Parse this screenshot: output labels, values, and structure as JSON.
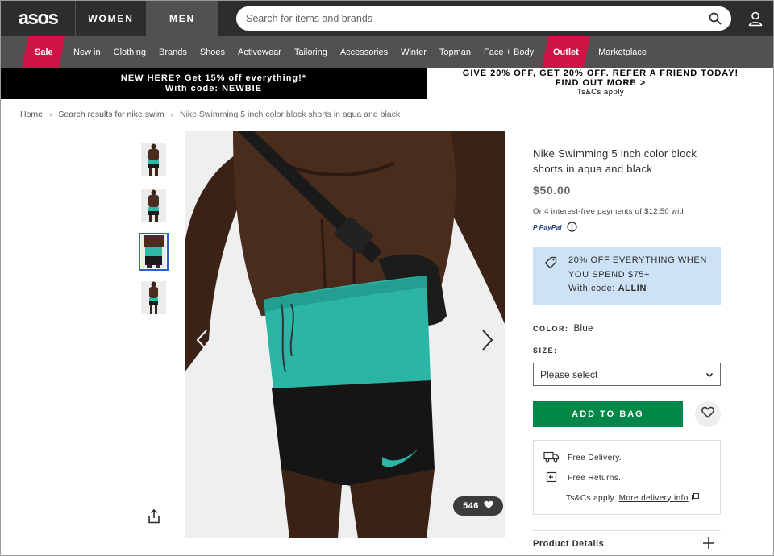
{
  "header": {
    "logo": "asos",
    "women": "WOMEN",
    "men": "MEN",
    "search_placeholder": "Search for items and brands",
    "icons": {
      "search": "search-icon",
      "account": "account-icon"
    }
  },
  "nav": {
    "sale": "Sale",
    "items_a": [
      "New in",
      "Clothing",
      "Brands",
      "Shoes",
      "Activewear",
      "Tailoring",
      "Accessories",
      "Winter",
      "Topman",
      "Face + Body"
    ],
    "outlet": "Outlet",
    "marketplace": "Marketplace",
    "sale_color": "#d01345"
  },
  "promo": {
    "left_line1": "NEW HERE? Get 15% off everything!*",
    "left_line2": "With code: NEWBIE",
    "right_line1": "GIVE 20% OFF, GET 20% OFF. REFER A FRIEND TODAY!",
    "right_line2": "FIND OUT MORE >",
    "right_tc": "Ts&Cs apply"
  },
  "breadcrumb": [
    "Home",
    "Search results for nike swim",
    "Nike Swimming 5 inch color block shorts in aqua and black"
  ],
  "gallery": {
    "likes": "546",
    "active_thumb": 3
  },
  "product": {
    "title": "Nike Swimming 5 inch color block shorts in aqua and black",
    "price": "$50.00",
    "installments": "Or 4 interest-free payments of $12.50 with",
    "paypal_a": "P PayPal"
  },
  "promo_box": {
    "line1": "20% OFF EVERYTHING WHEN",
    "line2": "YOU SPEND $75+",
    "code_label": "With code: ",
    "code": "ALLIN",
    "bg": "#cde2f5"
  },
  "options": {
    "color_label": "COLOR:",
    "color_value": "Blue",
    "size_label": "SIZE:",
    "size_placeholder": "Please select"
  },
  "actions": {
    "add_to_bag": "ADD TO BAG",
    "add_color": "#018849"
  },
  "delivery": {
    "free_delivery": "Free Delivery.",
    "free_returns": "Free Returns.",
    "tcs": "Ts&Cs apply. ",
    "more_info": "More delivery info"
  },
  "details": {
    "label": "Product Details"
  }
}
